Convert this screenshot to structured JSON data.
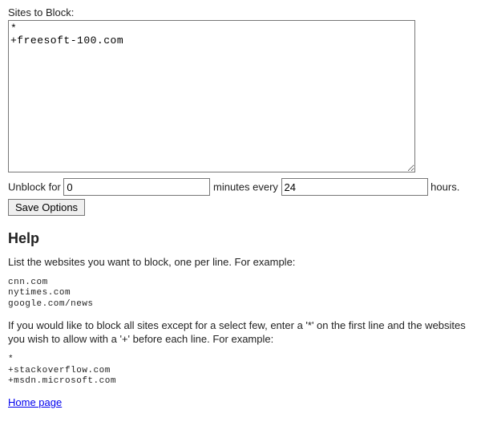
{
  "form": {
    "sites_label": "Sites to Block:",
    "sites_value": "*\n+freesoft-100.com",
    "unblock_for_label": "Unblock for",
    "unblock_for_value": "0",
    "minutes_every_label": "minutes every",
    "minutes_every_value": "24",
    "hours_label": "hours.",
    "save_button": "Save Options"
  },
  "help": {
    "heading": "Help",
    "intro": "List the websites you want to block, one per line. For example:",
    "example1": "cnn.com\nnytimes.com\ngoogle.com/news",
    "allow_text": "If you would like to block all sites except for a select few, enter a '*' on the first line and the websites you wish to allow with a '+' before each line. For example:",
    "example2": "*\n+stackoverflow.com\n+msdn.microsoft.com",
    "home_link": "Home page"
  }
}
